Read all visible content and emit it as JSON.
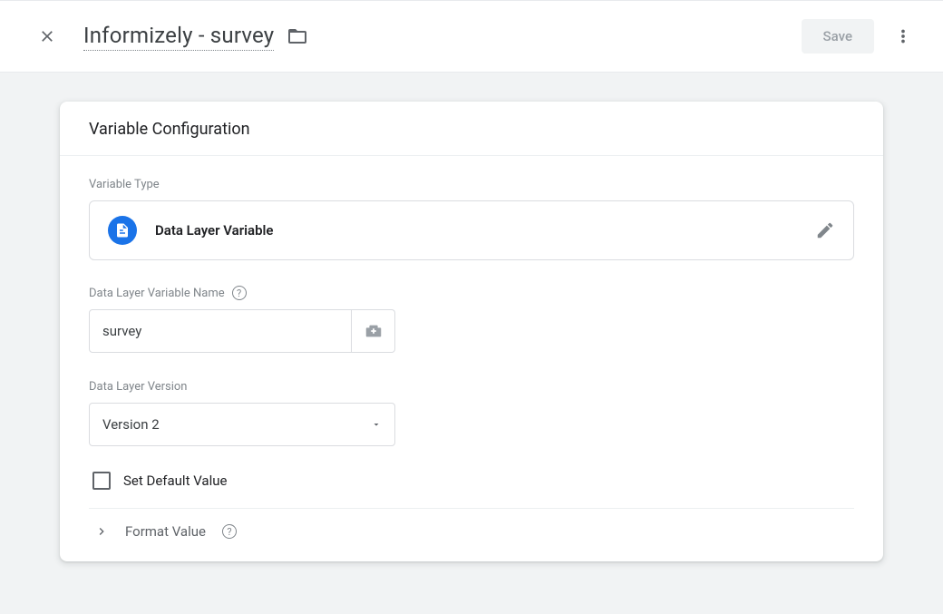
{
  "header": {
    "title": "Informizely - survey",
    "save_label": "Save"
  },
  "card": {
    "title": "Variable Configuration",
    "variable_type_label": "Variable Type",
    "variable_type_value": "Data Layer Variable",
    "name_label": "Data Layer Variable Name",
    "name_value": "survey",
    "version_label": "Data Layer Version",
    "version_value": "Version 2",
    "default_label": "Set Default Value",
    "format_label": "Format Value"
  }
}
